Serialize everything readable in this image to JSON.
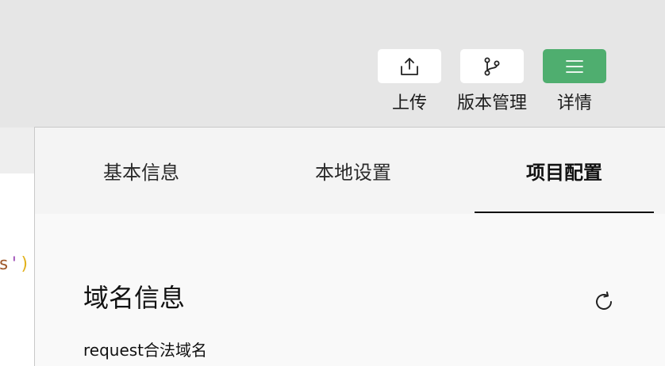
{
  "toolbar": {
    "upload_label": "上传",
    "version_label": "版本管理",
    "details_label": "详情",
    "accent_color": "#4fae6f"
  },
  "editor": {
    "code_s": "s",
    "code_quote": "'",
    "code_paren": ")"
  },
  "panel": {
    "tabs": [
      {
        "label": "基本信息",
        "active": false
      },
      {
        "label": "本地设置",
        "active": false
      },
      {
        "label": "项目配置",
        "active": true
      }
    ],
    "section_title": "域名信息",
    "field_label": "request合法域名"
  }
}
